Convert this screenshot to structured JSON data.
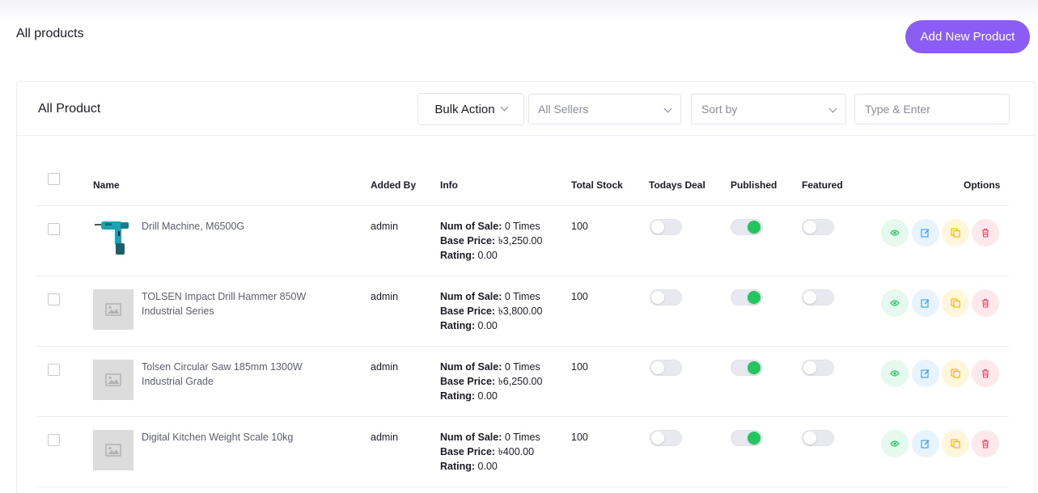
{
  "header": {
    "title": "All products",
    "add_button": "Add New Product"
  },
  "card": {
    "title": "All Product",
    "bulk_action": "Bulk Action",
    "sellers_select": "All Sellers",
    "sort_select": "Sort by",
    "search_placeholder": "Type & Enter"
  },
  "table": {
    "columns": {
      "name": "Name",
      "added_by": "Added By",
      "info": "Info",
      "total_stock": "Total Stock",
      "todays_deal": "Todays Deal",
      "published": "Published",
      "featured": "Featured",
      "options": "Options"
    },
    "info_labels": {
      "sales": "Num of Sale:",
      "price": "Base Price:",
      "rating": "Rating:"
    },
    "rows": [
      {
        "name": "Drill Machine, M6500G",
        "added_by": "admin",
        "sales": " 0 Times",
        "price": " ৳3,250.00",
        "rating": " 0.00",
        "stock": "100",
        "todays_deal": false,
        "published": true,
        "featured": false,
        "thumb": "drill-photo"
      },
      {
        "name": "TOLSEN Impact Drill Hammer 850W Industrial Series",
        "added_by": "admin",
        "sales": " 0 Times",
        "price": " ৳3,800.00",
        "rating": " 0.00",
        "stock": "100",
        "todays_deal": false,
        "published": true,
        "featured": false,
        "thumb": "image-placeholder"
      },
      {
        "name": "Tolsen Circular Saw 185mm 1300W Industrial Grade",
        "added_by": "admin",
        "sales": " 0 Times",
        "price": " ৳6,250.00",
        "rating": " 0.00",
        "stock": "100",
        "todays_deal": false,
        "published": true,
        "featured": false,
        "thumb": "image-placeholder"
      },
      {
        "name": "Digital Kitchen Weight Scale 10kg",
        "added_by": "admin",
        "sales": " 0 Times",
        "price": " ৳400.00",
        "rating": " 0.00",
        "stock": "100",
        "todays_deal": false,
        "published": true,
        "featured": false,
        "thumb": "image-placeholder"
      }
    ]
  },
  "colors": {
    "accent": "#8b5cf6",
    "toggle_on": "#22c55e",
    "view": "#22c55e",
    "edit": "#3b9ae6",
    "copy": "#f5b301",
    "delete": "#ef4565"
  },
  "icons": [
    "chevron-down-icon",
    "eye-icon",
    "edit-icon",
    "copy-icon",
    "trash-icon",
    "image-placeholder-icon"
  ]
}
